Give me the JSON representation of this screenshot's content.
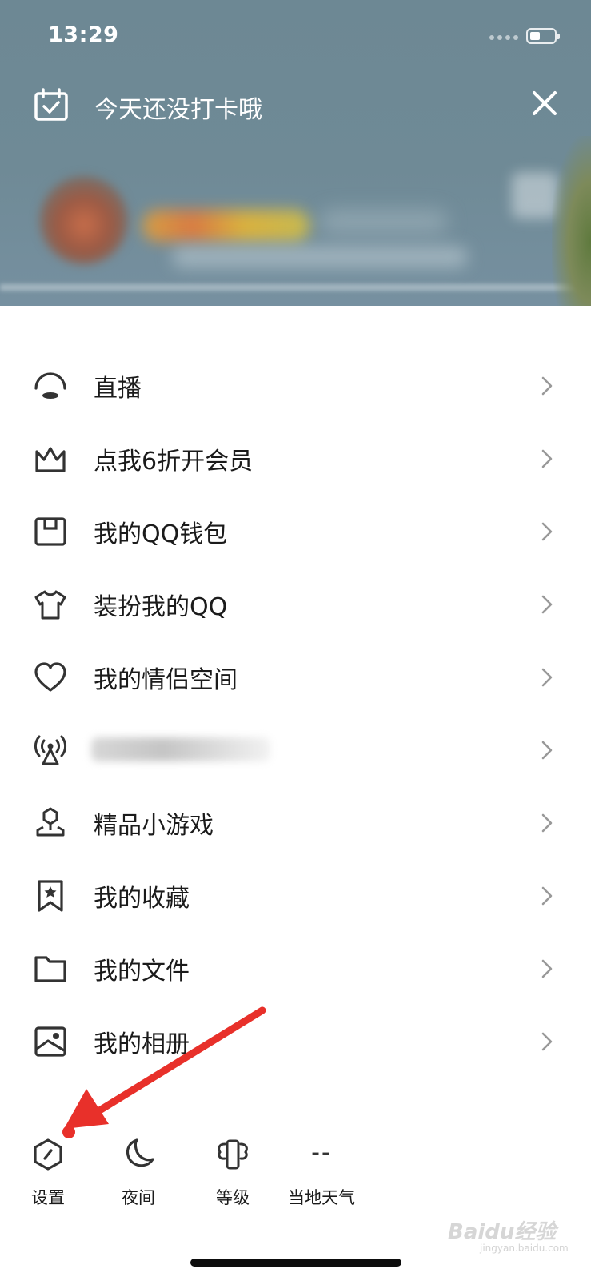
{
  "status_bar": {
    "time": "13:29"
  },
  "checkin": {
    "text": "今天还没打卡哦"
  },
  "menu": {
    "items": [
      {
        "label": "直播",
        "icon": "live-icon"
      },
      {
        "label": "点我6折开会员",
        "icon": "crown-icon"
      },
      {
        "label": "我的QQ钱包",
        "icon": "wallet-icon"
      },
      {
        "label": "装扮我的QQ",
        "icon": "tshirt-icon"
      },
      {
        "label": "我的情侣空间",
        "icon": "heart-icon"
      },
      {
        "label": "",
        "icon": "signal-tower-icon"
      },
      {
        "label": "精品小游戏",
        "icon": "game-icon"
      },
      {
        "label": "我的收藏",
        "icon": "bookmark-star-icon"
      },
      {
        "label": "我的文件",
        "icon": "folder-icon"
      },
      {
        "label": "我的相册",
        "icon": "photo-album-icon"
      }
    ]
  },
  "toolbar": {
    "settings": "设置",
    "night": "夜间",
    "level": "等级",
    "weather": "当地天气",
    "weather_value": "--"
  },
  "watermark": {
    "text": "Baidu经验",
    "sub": "jingyan.baidu.com"
  },
  "colors": {
    "header_bg": "#6f8a96",
    "annotation": "#e8302a"
  }
}
